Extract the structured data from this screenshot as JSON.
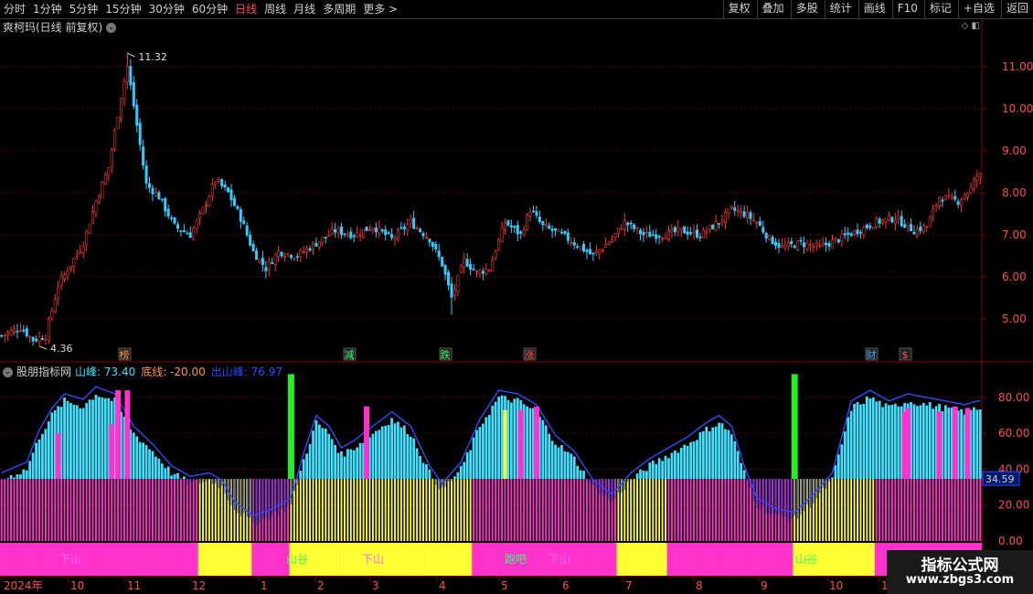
{
  "toolbar": {
    "periods": [
      {
        "label": "分时",
        "active": false
      },
      {
        "label": "1分钟",
        "active": false
      },
      {
        "label": "5分钟",
        "active": false
      },
      {
        "label": "15分钟",
        "active": false
      },
      {
        "label": "30分钟",
        "active": false
      },
      {
        "label": "60分钟",
        "active": false
      },
      {
        "label": "日线",
        "active": true
      },
      {
        "label": "周线",
        "active": false
      },
      {
        "label": "月线",
        "active": false
      },
      {
        "label": "多周期",
        "active": false
      },
      {
        "label": "更多 >",
        "active": false
      }
    ],
    "buttons": [
      "复权",
      "叠加",
      "多股",
      "统计",
      "画线",
      "F10",
      "标记",
      "+自选",
      "返回"
    ]
  },
  "main": {
    "title": "爽柯玛(日线 前复权)",
    "price_ticks": [
      "11.00",
      "10.00",
      "9.00",
      "8.00",
      "7.00",
      "6.00",
      "5.00"
    ],
    "high_label": "11.32",
    "low_label": "4.36",
    "markers": [
      {
        "text": "榜",
        "color": "#ff9933"
      },
      {
        "text": "减",
        "color": "#33ff66"
      },
      {
        "text": "跌",
        "color": "#33ff66"
      },
      {
        "text": "涨",
        "color": "#ff4d4d"
      },
      {
        "text": "财",
        "color": "#4da6ff"
      },
      {
        "text": "$",
        "color": "#ff4d4d"
      }
    ]
  },
  "indicator": {
    "name": "股朋指标网",
    "peak_label": "山峰: 73.40",
    "base_label": "底线: -20.00",
    "out_label": "出山峰: 76.97",
    "ticks": [
      "80.00",
      "60.00",
      "40.00",
      "20.00",
      "0.00"
    ],
    "current_value": "34.59",
    "band_labels": [
      {
        "text": "下山",
        "color": "#ff66ff"
      },
      {
        "text": "山谷",
        "color": "#33ff66"
      },
      {
        "text": "下山",
        "color": "#ff66ff"
      },
      {
        "text": "跑吧",
        "color": "#33ff66"
      },
      {
        "text": "下山",
        "color": "#ff66ff"
      },
      {
        "text": "山谷",
        "color": "#33ff66"
      }
    ]
  },
  "xaxis": {
    "labels": [
      "2024年",
      "10",
      "11",
      "12",
      "1",
      "2",
      "3",
      "4",
      "5",
      "6",
      "7",
      "8",
      "9",
      "10",
      "1"
    ]
  },
  "watermark": {
    "line1": "指标公式网",
    "line2": "www.zbgs3.com"
  },
  "colors": {
    "up": "#ff3333",
    "down": "#33ccff",
    "grid": "#5a0000",
    "axis": "#8b0000",
    "peak_line": "#2f4cff",
    "cyan_fill": "#40e0ff",
    "magenta": "#ff33cc",
    "yellow": "#ffff33",
    "green_bar": "#22ee22"
  },
  "chart_data": {
    "type": "candlestick",
    "ylim": [
      4.0,
      11.8
    ],
    "close_keypoints": [
      [
        0,
        4.6
      ],
      [
        6,
        4.8
      ],
      [
        10,
        4.5
      ],
      [
        14,
        4.6
      ],
      [
        18,
        5.8
      ],
      [
        22,
        6.3
      ],
      [
        26,
        6.8
      ],
      [
        30,
        7.8
      ],
      [
        34,
        8.6
      ],
      [
        38,
        10.3
      ],
      [
        40,
        11.0
      ],
      [
        43,
        9.6
      ],
      [
        46,
        8.2
      ],
      [
        50,
        7.9
      ],
      [
        55,
        7.2
      ],
      [
        60,
        7.0
      ],
      [
        64,
        7.6
      ],
      [
        68,
        8.3
      ],
      [
        72,
        8.0
      ],
      [
        76,
        7.4
      ],
      [
        80,
        6.6
      ],
      [
        84,
        6.2
      ],
      [
        88,
        6.6
      ],
      [
        94,
        6.5
      ],
      [
        100,
        6.8
      ],
      [
        106,
        7.1
      ],
      [
        112,
        7.0
      ],
      [
        118,
        7.2
      ],
      [
        124,
        6.9
      ],
      [
        130,
        7.3
      ],
      [
        136,
        6.9
      ],
      [
        140,
        6.3
      ],
      [
        143,
        5.5
      ],
      [
        147,
        6.4
      ],
      [
        151,
        6.1
      ],
      [
        155,
        6.2
      ],
      [
        160,
        7.3
      ],
      [
        165,
        7.0
      ],
      [
        168,
        7.6
      ],
      [
        172,
        7.2
      ],
      [
        178,
        7.0
      ],
      [
        184,
        6.7
      ],
      [
        188,
        6.5
      ],
      [
        194,
        6.9
      ],
      [
        198,
        7.3
      ],
      [
        204,
        7.0
      ],
      [
        210,
        7.0
      ],
      [
        216,
        7.1
      ],
      [
        222,
        7.0
      ],
      [
        228,
        7.3
      ],
      [
        232,
        7.6
      ],
      [
        236,
        7.5
      ],
      [
        240,
        7.3
      ],
      [
        244,
        6.9
      ],
      [
        248,
        6.7
      ],
      [
        254,
        6.8
      ],
      [
        260,
        6.7
      ],
      [
        266,
        6.9
      ],
      [
        272,
        7.1
      ],
      [
        278,
        7.3
      ],
      [
        284,
        7.4
      ],
      [
        290,
        7.1
      ],
      [
        294,
        7.2
      ],
      [
        298,
        7.9
      ],
      [
        304,
        7.8
      ],
      [
        308,
        8.1
      ],
      [
        310,
        8.4
      ]
    ],
    "indicator_peak_keypoints": [
      [
        0,
        34
      ],
      [
        8,
        40
      ],
      [
        12,
        58
      ],
      [
        16,
        70
      ],
      [
        20,
        78
      ],
      [
        26,
        75
      ],
      [
        30,
        82
      ],
      [
        36,
        78
      ],
      [
        42,
        60
      ],
      [
        48,
        50
      ],
      [
        54,
        38
      ],
      [
        60,
        32
      ],
      [
        66,
        34
      ],
      [
        70,
        30
      ],
      [
        74,
        18
      ],
      [
        80,
        10
      ],
      [
        86,
        14
      ],
      [
        92,
        20
      ],
      [
        96,
        45
      ],
      [
        100,
        66
      ],
      [
        104,
        60
      ],
      [
        108,
        48
      ],
      [
        112,
        52
      ],
      [
        118,
        60
      ],
      [
        124,
        68
      ],
      [
        130,
        60
      ],
      [
        136,
        38
      ],
      [
        140,
        28
      ],
      [
        146,
        40
      ],
      [
        152,
        64
      ],
      [
        158,
        80
      ],
      [
        164,
        78
      ],
      [
        170,
        72
      ],
      [
        176,
        55
      ],
      [
        182,
        46
      ],
      [
        188,
        30
      ],
      [
        194,
        22
      ],
      [
        200,
        34
      ],
      [
        206,
        42
      ],
      [
        212,
        48
      ],
      [
        218,
        54
      ],
      [
        224,
        62
      ],
      [
        228,
        66
      ],
      [
        232,
        60
      ],
      [
        236,
        38
      ],
      [
        240,
        20
      ],
      [
        246,
        14
      ],
      [
        252,
        12
      ],
      [
        258,
        22
      ],
      [
        264,
        34
      ],
      [
        270,
        74
      ],
      [
        276,
        80
      ],
      [
        282,
        74
      ],
      [
        288,
        78
      ],
      [
        294,
        76
      ],
      [
        300,
        74
      ],
      [
        306,
        72
      ],
      [
        310,
        74
      ]
    ]
  }
}
